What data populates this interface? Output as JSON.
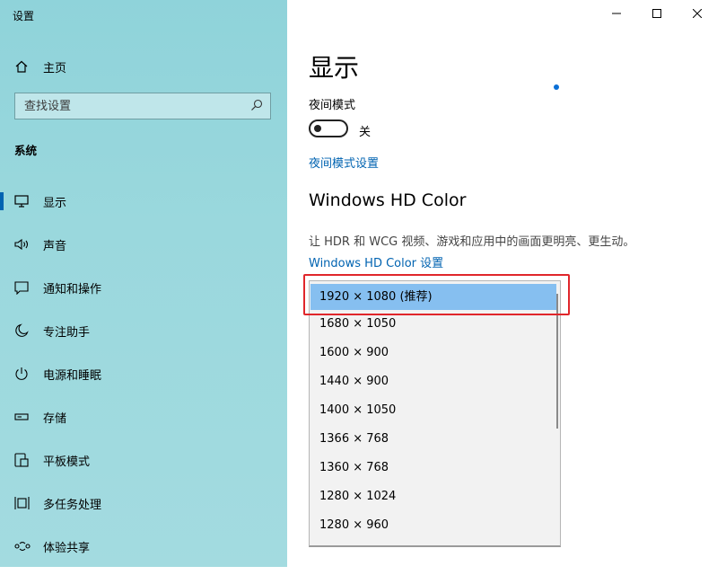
{
  "app": {
    "title": "设置"
  },
  "window_controls": {
    "minimize": "—",
    "maximize": "☐",
    "close": "✕"
  },
  "sidebar": {
    "home_label": "主页",
    "search_placeholder": "查找设置",
    "section_label": "系统",
    "items": [
      {
        "label": "显示",
        "icon": "monitor-icon",
        "active": true
      },
      {
        "label": "声音",
        "icon": "speaker-icon",
        "active": false
      },
      {
        "label": "通知和操作",
        "icon": "notification-icon",
        "active": false
      },
      {
        "label": "专注助手",
        "icon": "moon-icon",
        "active": false
      },
      {
        "label": "电源和睡眠",
        "icon": "power-icon",
        "active": false
      },
      {
        "label": "存储",
        "icon": "storage-icon",
        "active": false
      },
      {
        "label": "平板模式",
        "icon": "tablet-icon",
        "active": false
      },
      {
        "label": "多任务处理",
        "icon": "multitask-icon",
        "active": false
      },
      {
        "label": "体验共享",
        "icon": "share-icon",
        "active": false
      }
    ]
  },
  "main": {
    "title": "显示",
    "night_mode": {
      "label": "夜间模式",
      "state_label": "关",
      "on": false,
      "settings_link": "夜间模式设置"
    },
    "hd_color": {
      "heading": "Windows HD Color",
      "description": "让 HDR 和 WCG 视频、游戏和应用中的画面更明亮、更生动。",
      "settings_link": "Windows HD Color 设置"
    },
    "resolution_dropdown": {
      "options": [
        "1920 × 1080 (推荐)",
        "1680 × 1050",
        "1600 × 900",
        "1440 × 900",
        "1400 × 1050",
        "1366 × 768",
        "1360 × 768",
        "1280 × 1024",
        "1280 × 960"
      ],
      "selected_index": 0
    }
  },
  "colors": {
    "accent": "#0063b1",
    "sidebar_bg": "#9ad8dd",
    "selection": "#86bff0",
    "highlight_border": "#e0262b"
  }
}
